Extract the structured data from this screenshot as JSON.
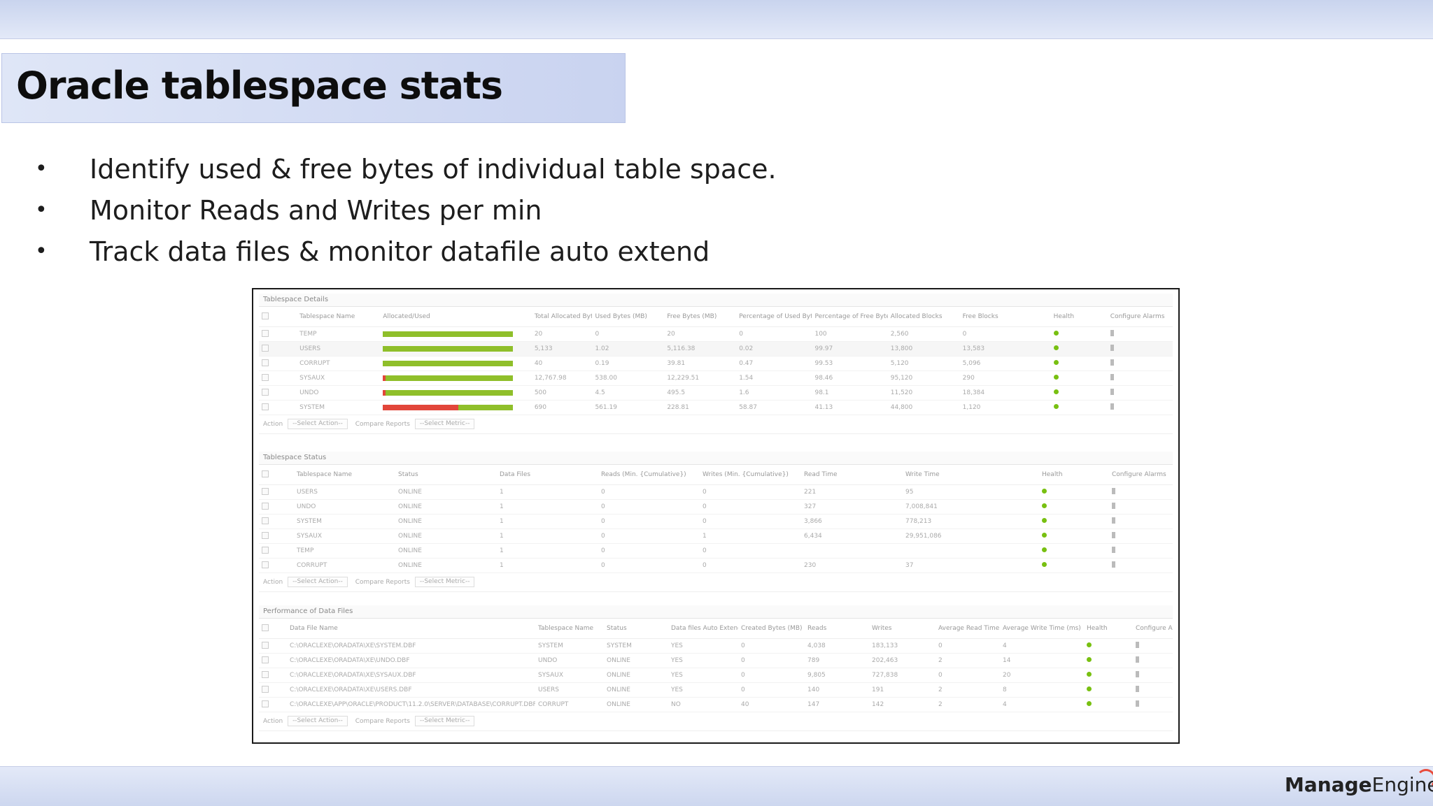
{
  "slide": {
    "title": "Oracle tablespace stats",
    "bullets": [
      "Identify used & free bytes of individual table space.",
      "Monitor Reads and Writes per min",
      "Track data files & monitor datafile auto extend"
    ],
    "logo": {
      "bold": "Manage",
      "regular": "Engine"
    }
  },
  "screenshot": {
    "details": {
      "title": "Tablespace Details",
      "columns": [
        "",
        "Tablespace Name",
        "Allocated/Used",
        "Total Allocated Bytes (MB)",
        "Used Bytes (MB)",
        "Free Bytes (MB)",
        "Percentage of Used Bytes (%)",
        "Percentage of Free Bytes (%)",
        "Allocated Blocks",
        "Free Blocks",
        "Health",
        "Configure Alarms"
      ],
      "rows": [
        {
          "name": "TEMP",
          "used_fraction": 0.0,
          "total": "20",
          "used": "0",
          "free": "20",
          "pct_used": "0",
          "pct_free": "100",
          "alloc_blocks": "2,560",
          "free_blocks": "0"
        },
        {
          "name": "USERS",
          "used_fraction": 0.0,
          "total": "5,133",
          "used": "1.02",
          "free": "5,116.38",
          "pct_used": "0.02",
          "pct_free": "99.97",
          "alloc_blocks": "13,800",
          "free_blocks": "13,583"
        },
        {
          "name": "CORRUPT",
          "used_fraction": 0.0,
          "total": "40",
          "used": "0.19",
          "free": "39.81",
          "pct_used": "0.47",
          "pct_free": "99.53",
          "alloc_blocks": "5,120",
          "free_blocks": "5,096"
        },
        {
          "name": "SYSAUX",
          "used_fraction": 0.02,
          "total": "12,767.98",
          "used": "538.00",
          "free": "12,229.51",
          "pct_used": "1.54",
          "pct_free": "98.46",
          "alloc_blocks": "95,120",
          "free_blocks": "290"
        },
        {
          "name": "UNDO",
          "used_fraction": 0.02,
          "total": "500",
          "used": "4.5",
          "free": "495.5",
          "pct_used": "1.6",
          "pct_free": "98.1",
          "alloc_blocks": "11,520",
          "free_blocks": "18,384"
        },
        {
          "name": "SYSTEM",
          "used_fraction": 0.58,
          "total": "690",
          "used": "561.19",
          "free": "228.81",
          "pct_used": "58.87",
          "pct_free": "41.13",
          "alloc_blocks": "44,800",
          "free_blocks": "1,120"
        }
      ],
      "action": {
        "label": "Action",
        "select": "--Select Action--",
        "compare": "Compare Reports",
        "metric": "--Select Metric--"
      }
    },
    "status": {
      "title": "Tablespace Status",
      "columns": [
        "",
        "Tablespace Name",
        "Status",
        "Data Files",
        "Reads (Min. {Cumulative})",
        "Writes (Min. {Cumulative})",
        "Read Time",
        "Write Time",
        "Health",
        "Configure Alarms"
      ],
      "rows": [
        {
          "name": "USERS",
          "status": "ONLINE",
          "files": "1",
          "reads": "0",
          "writes": "0",
          "read_time": "221",
          "write_time": "95"
        },
        {
          "name": "UNDO",
          "status": "ONLINE",
          "files": "1",
          "reads": "0",
          "writes": "0",
          "read_time": "327",
          "write_time": "7,008,841"
        },
        {
          "name": "SYSTEM",
          "status": "ONLINE",
          "files": "1",
          "reads": "0",
          "writes": "0",
          "read_time": "3,866",
          "write_time": "778,213"
        },
        {
          "name": "SYSAUX",
          "status": "ONLINE",
          "files": "1",
          "reads": "0",
          "writes": "1",
          "read_time": "6,434",
          "write_time": "29,951,086"
        },
        {
          "name": "TEMP",
          "status": "ONLINE",
          "files": "1",
          "reads": "0",
          "writes": "0",
          "read_time": "",
          "write_time": ""
        },
        {
          "name": "CORRUPT",
          "status": "ONLINE",
          "files": "1",
          "reads": "0",
          "writes": "0",
          "read_time": "230",
          "write_time": "37"
        }
      ],
      "action": {
        "label": "Action",
        "select": "--Select Action--",
        "compare": "Compare Reports",
        "metric": "--Select Metric--"
      }
    },
    "datafiles": {
      "title": "Performance of Data Files",
      "columns": [
        "",
        "Data File Name",
        "Tablespace Name",
        "Status",
        "Data files Auto Extend",
        "Created Bytes (MB)",
        "Reads",
        "Writes",
        "Average Read Time (ms)",
        "Average Write Time (ms)",
        "Health",
        "Configure Alarms"
      ],
      "rows": [
        {
          "file": "C:\\ORACLEXE\\ORADATA\\XE\\SYSTEM.DBF",
          "ts": "SYSTEM",
          "status": "SYSTEM",
          "auto": "YES",
          "created": "0",
          "reads": "4,038",
          "writes": "183,133",
          "avg_read": "0",
          "avg_write": "4"
        },
        {
          "file": "C:\\ORACLEXE\\ORADATA\\XE\\UNDO.DBF",
          "ts": "UNDO",
          "status": "ONLINE",
          "auto": "YES",
          "created": "0",
          "reads": "789",
          "writes": "202,463",
          "avg_read": "2",
          "avg_write": "14"
        },
        {
          "file": "C:\\ORACLEXE\\ORADATA\\XE\\SYSAUX.DBF",
          "ts": "SYSAUX",
          "status": "ONLINE",
          "auto": "YES",
          "created": "0",
          "reads": "9,805",
          "writes": "727,838",
          "avg_read": "0",
          "avg_write": "20"
        },
        {
          "file": "C:\\ORACLEXE\\ORADATA\\XE\\USERS.DBF",
          "ts": "USERS",
          "status": "ONLINE",
          "auto": "YES",
          "created": "0",
          "reads": "140",
          "writes": "191",
          "avg_read": "2",
          "avg_write": "8"
        },
        {
          "file": "C:\\ORACLEXE\\APP\\ORACLE\\PRODUCT\\11.2.0\\SERVER\\DATABASE\\CORRUPT.DBF",
          "ts": "CORRUPT",
          "status": "ONLINE",
          "auto": "NO",
          "created": "40",
          "reads": "147",
          "writes": "142",
          "avg_read": "2",
          "avg_write": "4"
        }
      ],
      "action": {
        "label": "Action",
        "select": "--Select Action--",
        "compare": "Compare Reports",
        "metric": "--Select Metric--"
      }
    }
  }
}
